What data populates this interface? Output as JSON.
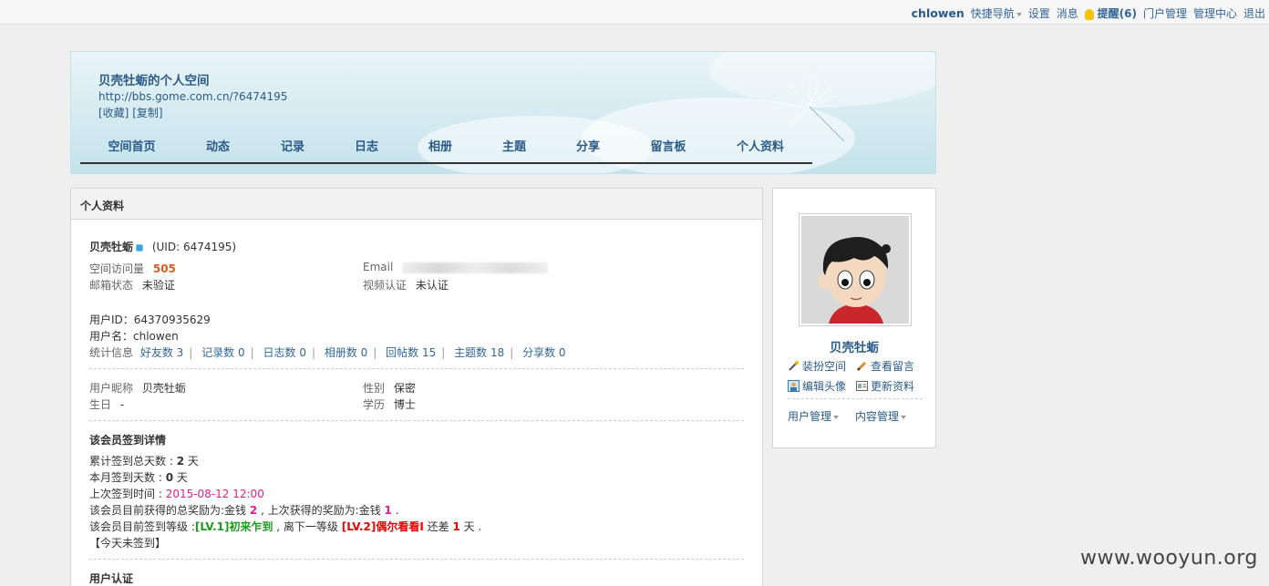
{
  "topbar": {
    "username": "chlowen",
    "quick_nav": "快捷导航",
    "settings": "设置",
    "messages": "消息",
    "reminders": "提醒(6)",
    "portal_admin": "门户管理",
    "admin_center": "管理中心",
    "logout": "退出"
  },
  "banner": {
    "title": "贝壳牡蛎的个人空间",
    "url": "http://bbs.gome.com.cn/?6474195",
    "bookmark": "[收藏]",
    "copy": "[复制]",
    "nav": [
      "空间首页",
      "动态",
      "记录",
      "日志",
      "相册",
      "主题",
      "分享",
      "留言板",
      "个人资料"
    ]
  },
  "profile": {
    "header": "个人资料",
    "name": "贝壳牡蛎",
    "uid": "(UID: 6474195)",
    "visits_label": "空间访问量",
    "visits": "505",
    "email_label": "Email",
    "email_status_label": "邮箱状态",
    "email_status": "未验证",
    "video_label": "视频认证",
    "video_status": "未认证",
    "user_id": "用户ID：64370935629",
    "username_line": "用户名：chlowen",
    "stats_label": "统计信息",
    "stats": [
      "好友数 3",
      "记录数 0",
      "日志数 0",
      "相册数 0",
      "回帖数 15",
      "主题数 18",
      "分享数 0"
    ],
    "nickname_label": "用户昵称",
    "nickname": "贝壳牡蛎",
    "gender_label": "性别",
    "gender": "保密",
    "birthday_label": "生日",
    "birthday": "-",
    "education_label": "学历",
    "education": "博士"
  },
  "signin": {
    "title": "该会员签到详情",
    "total_label": "累计签到总天数 : ",
    "total": "2",
    "total_unit": " 天",
    "month_label": "本月签到天数 : ",
    "month": "0",
    "month_unit": " 天",
    "last_label": "上次签到时间 : ",
    "last": "2015-08-12 12:00",
    "reward_prefix": "该会员目前获得的总奖励为:金钱 ",
    "reward_total": "2",
    "reward_mid": " , 上次获得的奖励为:金钱 ",
    "reward_last": "1",
    "reward_end": " .",
    "level_prefix": "该会员目前签到等级 :",
    "level_current": "[LV.1]初来乍到",
    "level_mid": " , 离下一等级 ",
    "level_next": "[LV.2]偶尔看看I",
    "level_diff_label": " 还差 ",
    "level_diff": "1",
    "level_end": " 天 .",
    "today": "【今天未签到】"
  },
  "auth_title": "用户认证",
  "side": {
    "name": "贝壳牡蛎",
    "decorate": "装扮空间",
    "view_messages": "查看留言",
    "edit_avatar": "编辑头像",
    "update_profile": "更新资料",
    "user_admin": "用户管理",
    "content_admin": "内容管理"
  },
  "watermark": "www.wooyun.org"
}
